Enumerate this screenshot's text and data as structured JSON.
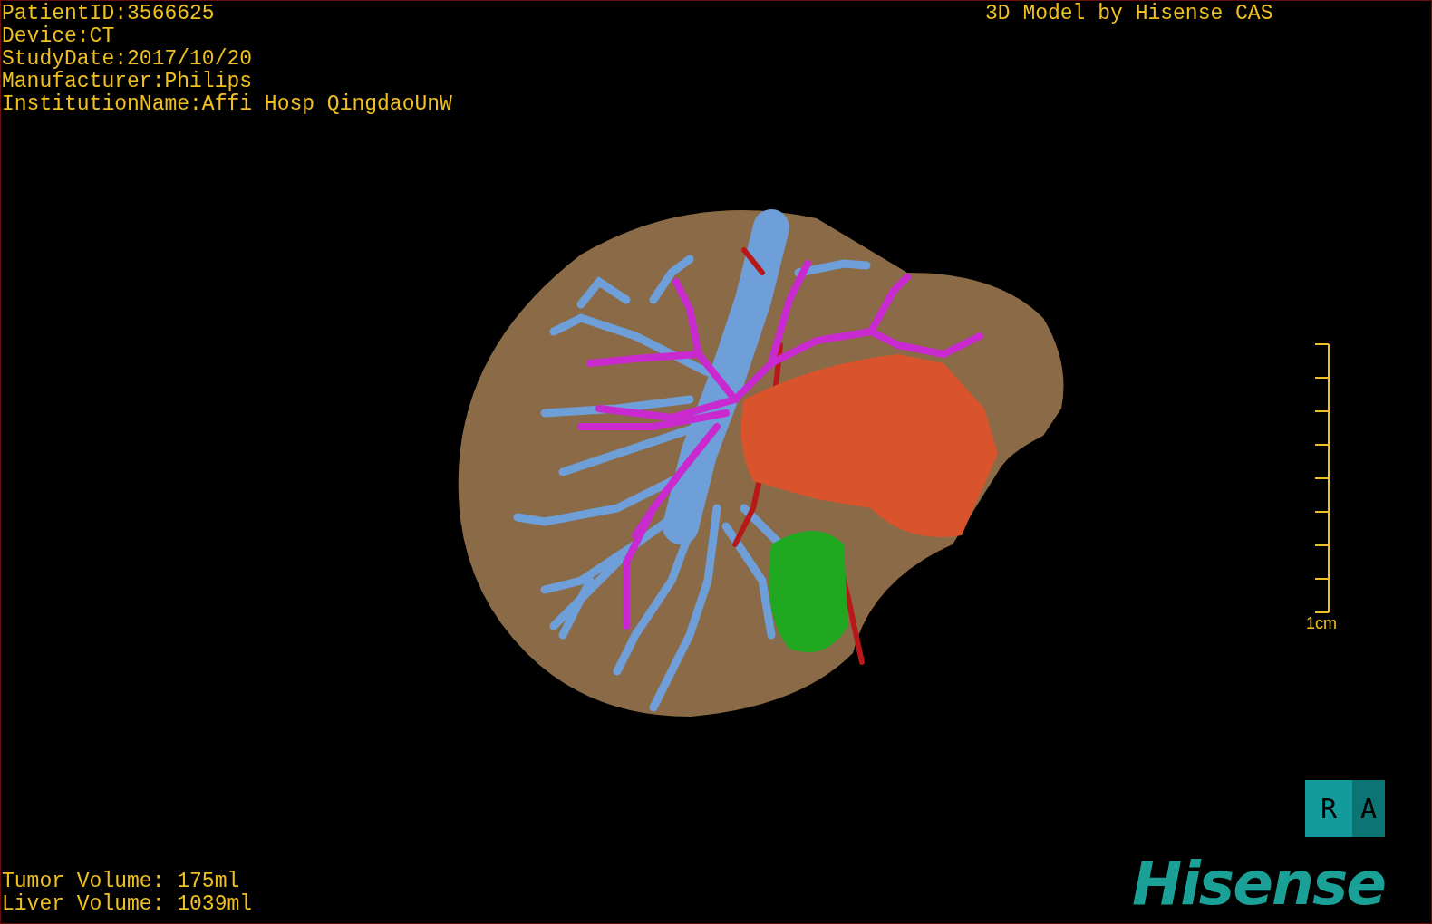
{
  "study_info": [
    "PatientID:3566625",
    "Device:CT",
    "StudyDate:2017/10/20",
    "Manufacturer:Philips",
    "InstitutionName:Affi Hosp QingdaoUnW"
  ],
  "title": "3D Model by Hisense CAS",
  "scale_bar": {
    "label": "1cm"
  },
  "orientation_cube": {
    "faces": [
      "R",
      "A"
    ]
  },
  "logo": "Hisense",
  "volumes": [
    "Tumor Volume: 175ml",
    "Liver Volume: 1039ml"
  ]
}
